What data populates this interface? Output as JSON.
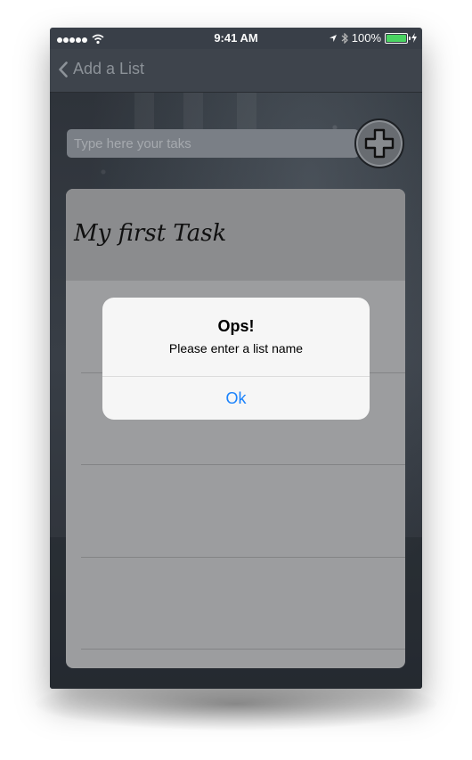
{
  "status_bar": {
    "time": "9:41 AM",
    "battery_percent": "100%",
    "icons": [
      "signal-dots",
      "wifi-icon",
      "location-arrow-icon",
      "bluetooth-icon",
      "battery-icon",
      "charging-bolt-icon"
    ]
  },
  "nav": {
    "back_label": "Add a List"
  },
  "task_input": {
    "value": "",
    "placeholder": "Type here your taks"
  },
  "add_button": {
    "icon": "plus-icon"
  },
  "list": {
    "title": "My first Task"
  },
  "alert": {
    "title": "Ops!",
    "message": "Please enter a list name",
    "button_label": "Ok"
  },
  "colors": {
    "accent": "#1a82fb",
    "battery": "#4cd964",
    "alert_bg": "#f6f6f6"
  }
}
